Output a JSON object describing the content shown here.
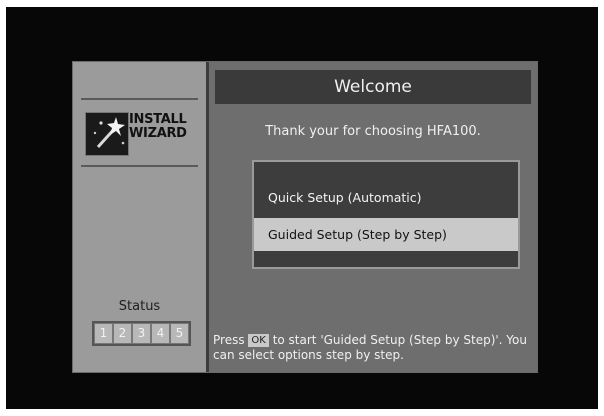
{
  "sidebar": {
    "logo_line1": "INSTALL",
    "logo_line2": "WIZARD",
    "status_label": "Status",
    "steps": [
      "1",
      "2",
      "3",
      "4",
      "5"
    ]
  },
  "main": {
    "title": "Welcome",
    "welcome_message": "Thank your for choosing HFA100.",
    "menu": {
      "items": [
        {
          "label": "Quick Setup (Automatic)",
          "selected": false
        },
        {
          "label": "Guided Setup (Step by Step)",
          "selected": true
        }
      ]
    },
    "help": {
      "prefix": "Press",
      "key": "OK",
      "text": "to start 'Guided Setup (Step by Step)'. You can select options step by step."
    }
  },
  "colors": {
    "screen_bg": "#070707",
    "sidebar_bg": "#9b9b9b",
    "main_bg": "#6e6e6e",
    "title_bar": "#3a3a3a",
    "highlight": "#c9c9c9"
  },
  "icons": {
    "logo": "magic-wand-icon"
  }
}
